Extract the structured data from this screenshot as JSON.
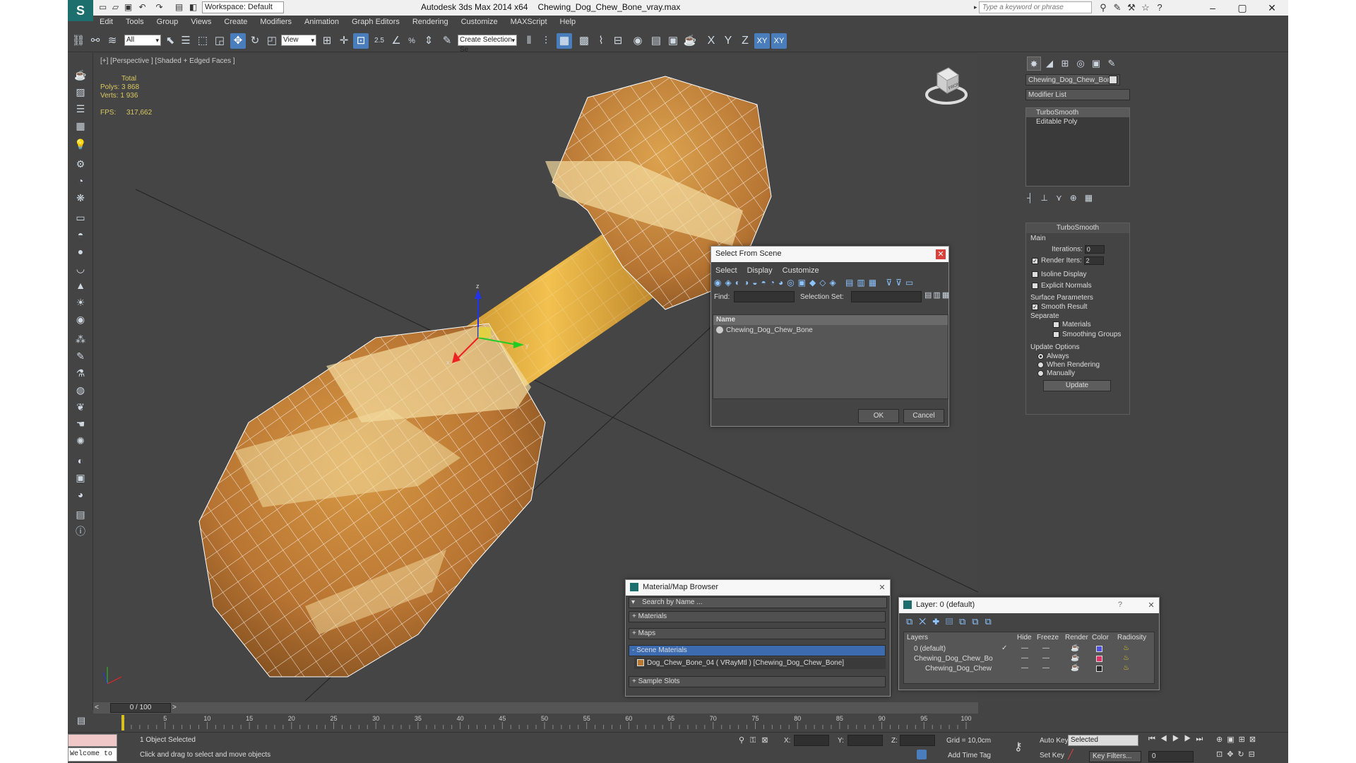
{
  "window": {
    "title": "Autodesk 3ds Max  2014 x64",
    "filename": "Chewing_Dog_Chew_Bone_vray.max",
    "workspace": "Workspace: Default",
    "search_placeholder": "Type a keyword or phrase"
  },
  "menu": [
    "Edit",
    "Tools",
    "Group",
    "Views",
    "Create",
    "Modifiers",
    "Animation",
    "Graph Editors",
    "Rendering",
    "Customize",
    "MAXScript",
    "Help"
  ],
  "toolbar": {
    "selection_filter": "All",
    "coord_system": "View",
    "named_selection": "Create Selection Se",
    "axis_labels": [
      "X",
      "Y",
      "Z",
      "XY",
      "XY"
    ],
    "snap_label": "2.5",
    "percent_label": "%"
  },
  "viewport": {
    "label": "[+] [Perspective ] [Shaded + Edged Faces ]",
    "stats": {
      "total_label": "Total",
      "polys_label": "Polys:",
      "polys": "3 868",
      "verts_label": "Verts:",
      "verts": "1 936",
      "fps_label": "FPS:",
      "fps": "317,662"
    },
    "gizmo": {
      "x": "x",
      "y": "y",
      "z": "z"
    },
    "viewcube_face": "FRONT"
  },
  "cmd_panel": {
    "object_name": "Chewing_Dog_Chew_Bone",
    "modifier_list": "Modifier List",
    "stack": [
      "TurboSmooth",
      "Editable Poly"
    ],
    "turbosmooth": {
      "header": "TurboSmooth",
      "main": "Main",
      "iterations_label": "Iterations:",
      "iterations": "0",
      "render_iters_label": "Render Iters:",
      "render_iters": "2",
      "isoline": "Isoline Display",
      "explicit_normals": "Explicit Normals",
      "surface_params": "Surface Parameters",
      "smooth_result": "Smooth Result",
      "separate": "Separate",
      "materials": "Materials",
      "smoothing_groups": "Smoothing Groups",
      "update_options": "Update Options",
      "always": "Always",
      "when_rendering": "When Rendering",
      "manually": "Manually",
      "update": "Update"
    }
  },
  "select_from_scene": {
    "title": "Select From Scene",
    "menus": [
      "Select",
      "Display",
      "Customize"
    ],
    "find_label": "Find:",
    "selection_set_label": "Selection Set:",
    "column_name": "Name",
    "items": [
      "Chewing_Dog_Chew_Bone"
    ],
    "ok": "OK",
    "cancel": "Cancel"
  },
  "material_browser": {
    "title": "Material/Map Browser",
    "search": "Search by Name ...",
    "groups": [
      "+ Materials",
      "+ Maps",
      "- Scene Materials",
      "+ Sample Slots"
    ],
    "scene_material": "Dog_Chew_Bone_04  ( VRayMtl )  [Chewing_Dog_Chew_Bone]"
  },
  "layer_dialog": {
    "title": "Layer: 0 (default)",
    "help": "?",
    "columns": [
      "Layers",
      "Hide",
      "Freeze",
      "Render",
      "Color",
      "Radiosity"
    ],
    "rows": [
      {
        "name": "0 (default)",
        "color": "#5050e0",
        "dash1": "—",
        "dash2": "—"
      },
      {
        "name": "Chewing_Dog_Chew_Bo",
        "color": "#e0306a",
        "dash1": "—",
        "dash2": "—"
      },
      {
        "name": "Chewing_Dog_Chew",
        "color": "#2a2a2a",
        "dash1": "—",
        "dash2": "—"
      }
    ]
  },
  "timeline": {
    "frame": "0 / 100",
    "ticks": [
      "0",
      "5",
      "10",
      "15",
      "20",
      "25",
      "30",
      "35",
      "40",
      "45",
      "50",
      "55",
      "60",
      "65",
      "70",
      "75",
      "80",
      "85",
      "90",
      "95",
      "100"
    ]
  },
  "status": {
    "maxscript": "Welcome to M",
    "selected": "1 Object Selected",
    "prompt": "Click and drag to select and move objects",
    "x_label": "X:",
    "y_label": "Y:",
    "z_label": "Z:",
    "grid": "Grid = 10,0cm",
    "auto_key": "Auto Key",
    "selected_dropdown": "Selected",
    "set_key": "Set Key",
    "key_filters": "Key Filters...",
    "add_time_tag": "Add Time Tag",
    "frame_field": "0"
  },
  "colors": {
    "accent": "#4a7dbb",
    "bone_light": "#e8b04a",
    "bone_dark": "#8a5a22"
  }
}
